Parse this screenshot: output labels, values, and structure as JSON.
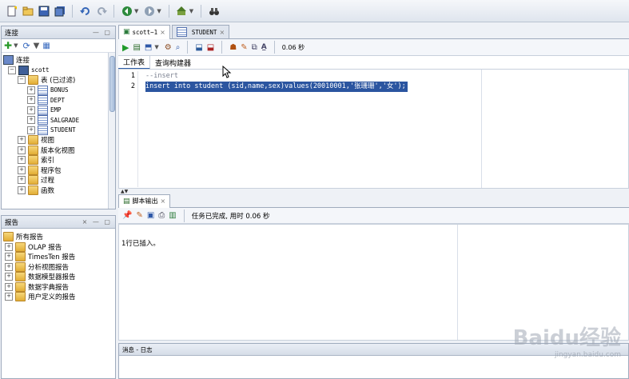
{
  "toolbar": {
    "icons": [
      "new-icon",
      "open-icon",
      "save-icon",
      "save-all-icon",
      "undo-icon",
      "redo-icon",
      "back-icon",
      "forward-icon",
      "run-icon",
      "binoculars-icon"
    ]
  },
  "connections_panel": {
    "title": "连接",
    "root": "连接",
    "connection": "scott",
    "tables_node": "表 (已过滤)",
    "tables": [
      "BONUS",
      "DEPT",
      "EMP",
      "SALGRADE",
      "STUDENT"
    ],
    "other_nodes": [
      "视图",
      "版本化视图",
      "索引",
      "程序包",
      "过程",
      "函数"
    ]
  },
  "reports_panel": {
    "title": "报告",
    "root": "所有报告",
    "items": [
      "OLAP 报告",
      "TimesTen 报告",
      "分析视图报告",
      "数据模型器报告",
      "数据字典报告",
      "用户定义的报告"
    ]
  },
  "editor": {
    "tabs": [
      {
        "label": "scott~1",
        "close": "×"
      },
      {
        "label": "STUDENT",
        "close": "×"
      }
    ],
    "run_time": "0.06 秒",
    "subtabs": [
      "工作表",
      "查询构建器"
    ],
    "line_numbers": [
      "1",
      "2"
    ],
    "lines": [
      "--insert",
      "insert into student (sid,name,sex)values(20010001,'张珊珊','女');"
    ]
  },
  "output": {
    "tab_label": "脚本输出",
    "tab_close": "×",
    "status": "任务已完成, 用时 0.06 秒",
    "message": "1行已插入。"
  },
  "log_panel": {
    "title": "消息 - 日志"
  },
  "watermark": {
    "text": "Baidu经验",
    "url": "jingyan.baidu.com"
  },
  "colors": {
    "accent": "#2f5fa8",
    "selection": "#2b55a0"
  }
}
